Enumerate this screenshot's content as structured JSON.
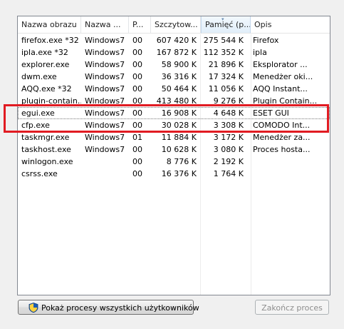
{
  "columns": [
    "Nazwa obrazu",
    "Nazwa ...",
    "P...",
    "Szczytow...",
    "Pamięć (p...",
    "Opis"
  ],
  "sorted_column_glyph": "▾",
  "processes": [
    {
      "name": "firefox.exe *32",
      "user": "Windows7",
      "cpu": "00",
      "peak": "607 420 K",
      "memory": "275 544 K",
      "description": "Firefox"
    },
    {
      "name": "ipla.exe *32",
      "user": "Windows7",
      "cpu": "00",
      "peak": "167 872 K",
      "memory": "112 352 K",
      "description": "ipla"
    },
    {
      "name": "explorer.exe",
      "user": "Windows7",
      "cpu": "00",
      "peak": "58 900 K",
      "memory": "21 896 K",
      "description": "Eksplorator ..."
    },
    {
      "name": "dwm.exe",
      "user": "Windows7",
      "cpu": "00",
      "peak": "36 316 K",
      "memory": "17 324 K",
      "description": "Menedżer oki..."
    },
    {
      "name": "AQQ.exe *32",
      "user": "Windows7",
      "cpu": "00",
      "peak": "50 464 K",
      "memory": "11 056 K",
      "description": "AQQ Instant..."
    },
    {
      "name": "plugin-contain...",
      "user": "Windows7",
      "cpu": "00",
      "peak": "413 480 K",
      "memory": "9 276 K",
      "description": "Plugin Contain..."
    },
    {
      "name": "egui.exe",
      "user": "Windows7",
      "cpu": "00",
      "peak": "16 908 K",
      "memory": "4 648 K",
      "description": "ESET GUI"
    },
    {
      "name": "cfp.exe",
      "user": "Windows7",
      "cpu": "00",
      "peak": "30 028 K",
      "memory": "3 308 K",
      "description": "COMODO Int..."
    },
    {
      "name": "taskmgr.exe",
      "user": "Windows7",
      "cpu": "01",
      "peak": "11 884 K",
      "memory": "3 172 K",
      "description": "Menedżer za..."
    },
    {
      "name": "taskhost.exe",
      "user": "Windows7",
      "cpu": "00",
      "peak": "10 628 K",
      "memory": "3 080 K",
      "description": "Proces hosta..."
    },
    {
      "name": "winlogon.exe",
      "user": "",
      "cpu": "00",
      "peak": "8 776 K",
      "memory": "2 192 K",
      "description": ""
    },
    {
      "name": "csrss.exe",
      "user": "",
      "cpu": "00",
      "peak": "16 376 K",
      "memory": "1 764 K",
      "description": ""
    }
  ],
  "buttons": {
    "show_all": "Pokaż procesy wszystkich użytkowników",
    "end_process": "Zakończ proces"
  },
  "colors": {
    "highlight_box": "#e11b22",
    "disabled_text": "#8d8d8d"
  },
  "icons": {
    "show_all_button": "uac-shield-icon"
  }
}
